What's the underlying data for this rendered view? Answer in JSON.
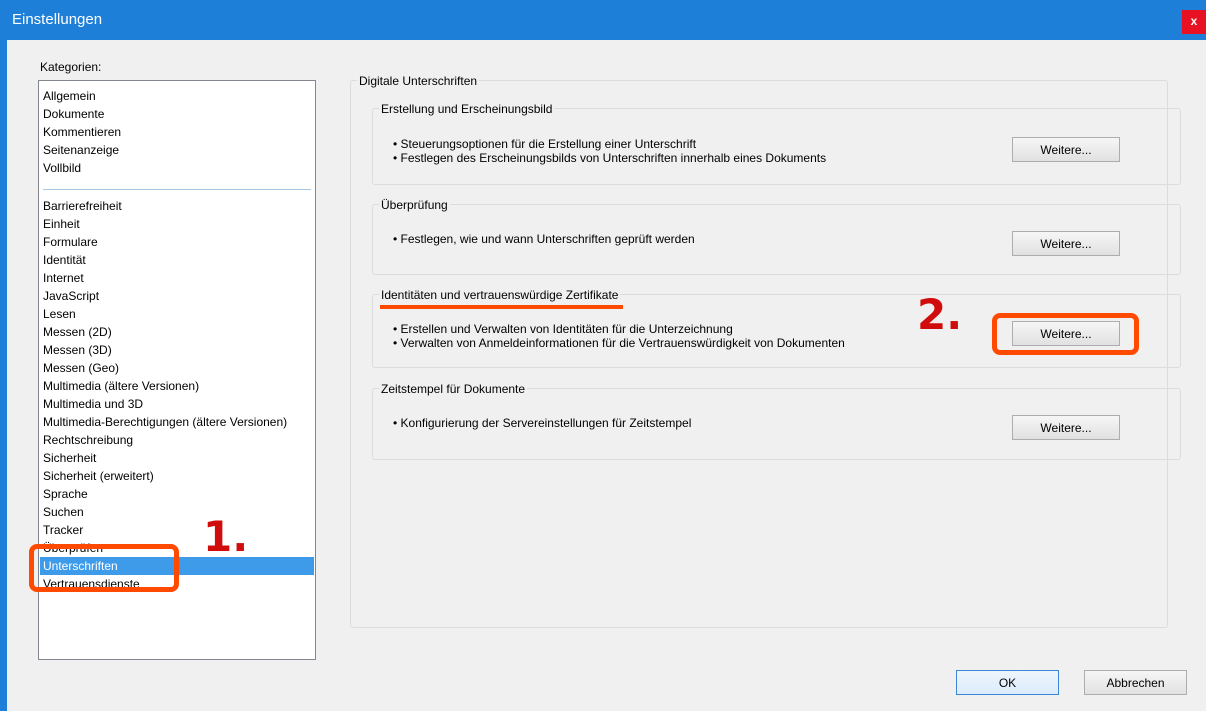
{
  "window": {
    "title": "Einstellungen",
    "close_label": "x"
  },
  "categories": {
    "label": "Kategorien:",
    "group1": [
      "Allgemein",
      "Dokumente",
      "Kommentieren",
      "Seitenanzeige",
      "Vollbild"
    ],
    "group2": [
      "Barrierefreiheit",
      "Einheit",
      "Formulare",
      "Identität",
      "Internet",
      "JavaScript",
      "Lesen",
      "Messen (2D)",
      "Messen (3D)",
      "Messen (Geo)",
      "Multimedia (ältere Versionen)",
      "Multimedia und 3D",
      "Multimedia-Berechtigungen (ältere Versionen)",
      "Rechtschreibung",
      "Sicherheit",
      "Sicherheit (erweitert)",
      "Sprache",
      "Suchen",
      "Tracker",
      "Überprüfen",
      "Unterschriften",
      "Vertrauensdienste"
    ],
    "selected": "Unterschriften"
  },
  "main": {
    "title": "Digitale Unterschriften",
    "sections": [
      {
        "title": "Erstellung und Erscheinungsbild",
        "bullets": [
          "• Steuerungsoptionen für die Erstellung einer Unterschrift",
          "• Festlegen des Erscheinungsbilds von Unterschriften innerhalb eines Dokuments"
        ],
        "button": "Weitere..."
      },
      {
        "title": "Überprüfung",
        "bullets": [
          "• Festlegen, wie und wann Unterschriften geprüft werden"
        ],
        "button": "Weitere..."
      },
      {
        "title": "Identitäten und vertrauenswürdige Zertifikate",
        "bullets": [
          "• Erstellen und Verwalten von Identitäten für die Unterzeichnung",
          "• Verwalten von Anmeldeinformationen für die Vertrauenswürdigkeit von Dokumenten"
        ],
        "button": "Weitere..."
      },
      {
        "title": "Zeitstempel für Dokumente",
        "bullets": [
          "• Konfigurierung der Servereinstellungen für Zeitstempel"
        ],
        "button": "Weitere..."
      }
    ]
  },
  "footer": {
    "ok_label": "OK",
    "cancel_label": "Abbrechen"
  },
  "annotations": {
    "step1": "1.",
    "step2": "2.",
    "highlight_color": "#ff4a00",
    "number_color": "#d10c0c"
  }
}
